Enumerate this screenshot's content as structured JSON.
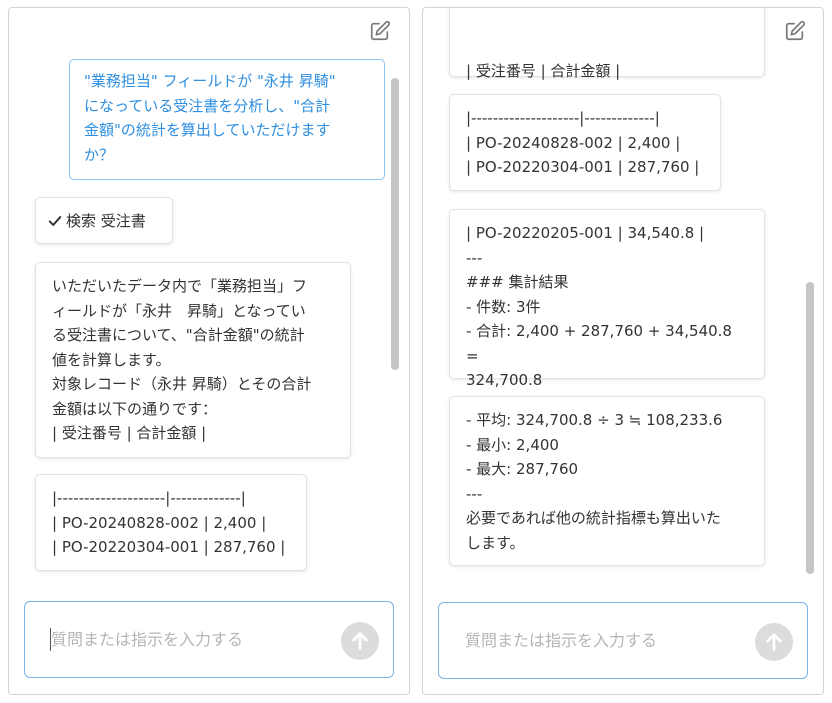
{
  "left_panel": {
    "user_message": "\"業務担当\" フィールドが \"永井 昇騎\"\nになっている受注書を分析し、\"合計\n金額\"の統計を算出していただけます\nか？",
    "tool_chip": {
      "label": "検索 受注書"
    },
    "bot_message_1": "いただいたデータ内で「業務担当」フ\nィールドが「永井　昇騎」となってい\nる受注書について、\"合計金額\"の統計\n値を計算します。\n対象レコード（永井 昇騎）とその合計\n金額は以下の通りです：\n| 受注番号 | 合計金額 |",
    "bot_message_2": "|--------------------|-------------|\n| PO-20240828-002 | 2,400 |\n| PO-20220304-001 | 287,760 |",
    "input": {
      "placeholder": "質問または指示を入力する"
    }
  },
  "right_panel": {
    "bot_message_partial": "| 受注番号 | 合計金額 |",
    "bot_message_table": "|--------------------|-------------|\n| PO-20240828-002 | 2,400 |\n| PO-20220304-001 | 287,760 |",
    "bot_message_summary": "| PO-20220205-001 | 34,540.8 |\n---\n### 集計結果\n- 件数: 3件\n- 合計: 2,400 + 287,760 + 34,540.8 =\n324,700.8",
    "bot_message_stats": "- 平均: 324,700.8 ÷ 3 ≒ 108,233.6\n- 最小: 2,400\n- 最大: 287,760\n---\n必要であれば他の統計指標も算出いた\nします。",
    "input": {
      "placeholder": "質問または指示を入力する"
    }
  },
  "colors": {
    "user_text": "#2f8fe0",
    "user_border": "#8fc3ef",
    "input_border": "#7ab4e8",
    "send_button_bg": "#dcdcdc",
    "scrollbar": "#c6c6c6"
  },
  "icons": {
    "edit": "edit-icon",
    "check": "check-icon",
    "send": "arrow-up-icon"
  }
}
